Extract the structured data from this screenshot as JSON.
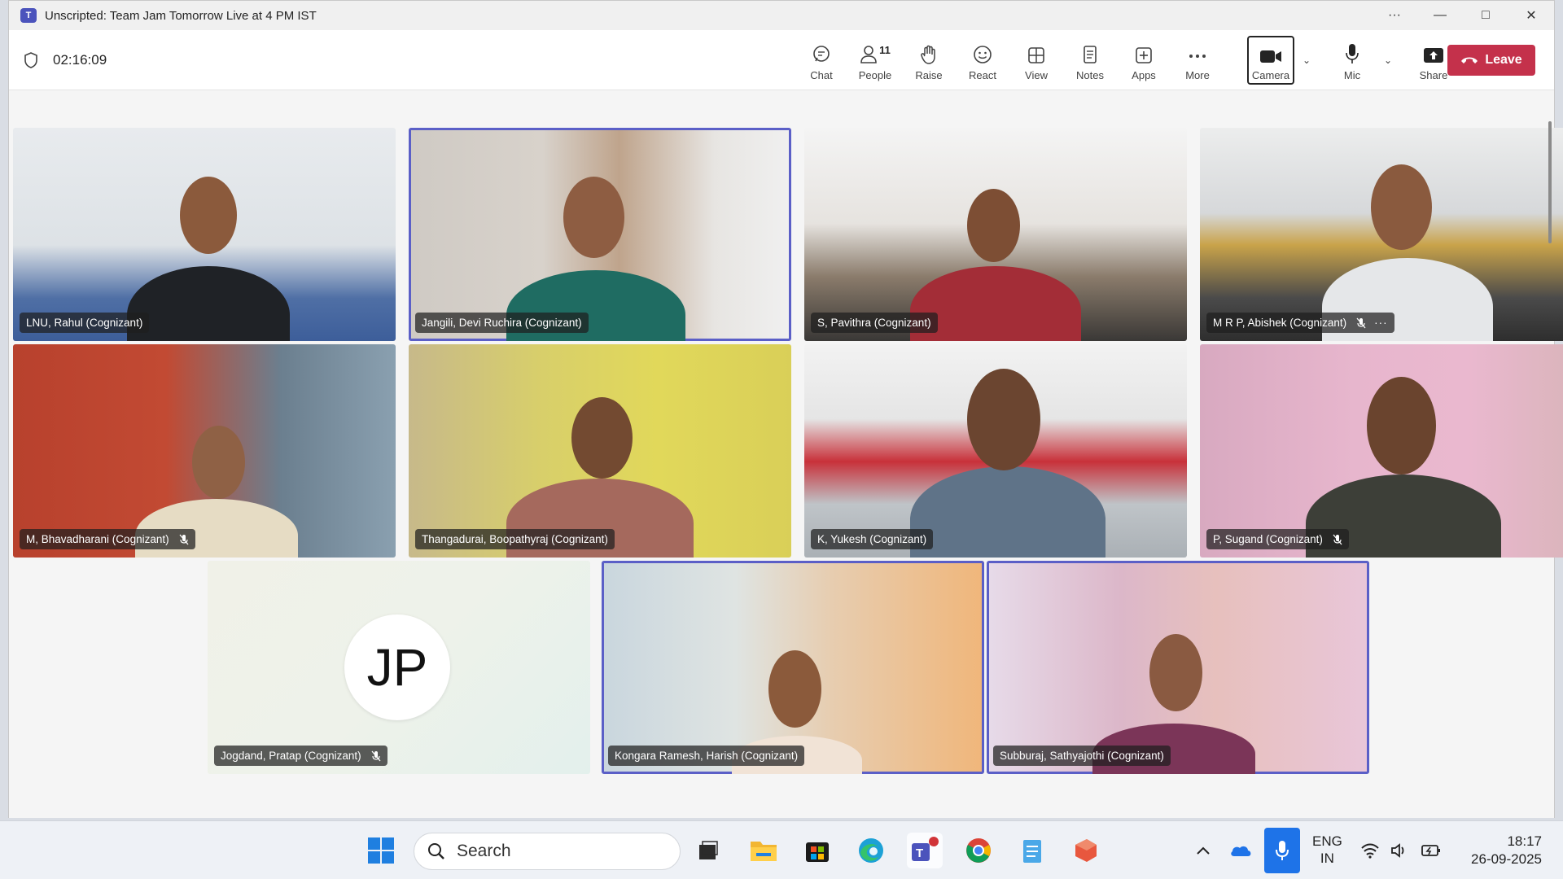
{
  "window": {
    "title": "Unscripted: Team Jam Tomorrow Live at 4 PM IST",
    "app_icon": "teams-icon",
    "controls": [
      "more-icon",
      "minimize-icon",
      "maximize-icon",
      "close-icon"
    ]
  },
  "meeting": {
    "elapsed": "02:16:09"
  },
  "toolbar": {
    "chat": "Chat",
    "people": "People",
    "people_count": "11",
    "raise": "Raise",
    "react": "React",
    "view": "View",
    "notes": "Notes",
    "apps": "Apps",
    "more": "More",
    "camera": "Camera",
    "mic": "Mic",
    "share": "Share",
    "leave": "Leave",
    "leave_color": "#c4314b"
  },
  "participants": [
    {
      "name": "LNU, Rahul (Cognizant)",
      "muted": false,
      "speaking": false
    },
    {
      "name": "Jangili, Devi Ruchira (Cognizant)",
      "muted": false,
      "speaking": true
    },
    {
      "name": "S, Pavithra (Cognizant)",
      "muted": false,
      "speaking": false
    },
    {
      "name": "M R P, Abishek (Cognizant)",
      "muted": true,
      "speaking": false
    },
    {
      "name": "M, Bhavadharani (Cognizant)",
      "muted": true,
      "speaking": false
    },
    {
      "name": "Thangadurai, Boopathyraj (Cognizant)",
      "muted": false,
      "speaking": false
    },
    {
      "name": "K, Yukesh (Cognizant)",
      "muted": false,
      "speaking": false
    },
    {
      "name": "P, Sugand (Cognizant)",
      "muted": true,
      "speaking": false
    },
    {
      "name": "Jogdand, Pratap (Cognizant)",
      "muted": true,
      "speaking": false,
      "initials": "JP"
    },
    {
      "name": "Kongara Ramesh, Harish (Cognizant)",
      "muted": false,
      "speaking": true
    },
    {
      "name": "Subburaj, Sathyajothi (Cognizant)",
      "muted": false,
      "speaking": true
    }
  ],
  "taskbar": {
    "search_placeholder": "Search",
    "language": "ENG",
    "region": "IN",
    "time": "18:17",
    "date": "26-09-2025",
    "apps": [
      "start-icon",
      "task-view-icon",
      "file-explorer-icon",
      "store-icon",
      "edge-icon",
      "teams-icon",
      "chrome-icon",
      "notepad-icon",
      "office-icon"
    ]
  }
}
